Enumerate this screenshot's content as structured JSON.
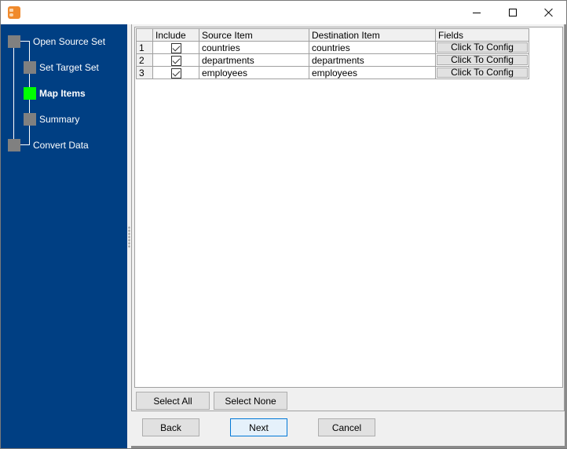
{
  "window": {
    "icon": "app-icon",
    "controls": {
      "minimize": "minimize-icon",
      "maximize": "maximize-icon",
      "close": "close-icon"
    }
  },
  "sidebar": {
    "steps": [
      {
        "label": "Open Source Set",
        "state": "pending",
        "level": 0
      },
      {
        "label": "Set Target Set",
        "state": "pending",
        "level": 1
      },
      {
        "label": "Map Items",
        "state": "active",
        "level": 1
      },
      {
        "label": "Summary",
        "state": "pending",
        "level": 1
      },
      {
        "label": "Convert Data",
        "state": "pending",
        "level": 0
      }
    ],
    "active_color": "#00ff00",
    "pending_color": "#808080",
    "background": "#003f83"
  },
  "grid": {
    "columns": [
      "",
      "Include",
      "Source Item",
      "Destination Item",
      "Fields"
    ],
    "rows": [
      {
        "num": "1",
        "include": true,
        "source": "countries",
        "destination": "countries",
        "fields": "Click To Config"
      },
      {
        "num": "2",
        "include": true,
        "source": "departments",
        "destination": "departments",
        "fields": "Click To Config"
      },
      {
        "num": "3",
        "include": true,
        "source": "employees",
        "destination": "employees",
        "fields": "Click To Config"
      }
    ]
  },
  "selection": {
    "select_all": "Select All",
    "select_none": "Select None"
  },
  "navigation": {
    "back": "Back",
    "next": "Next",
    "cancel": "Cancel"
  }
}
